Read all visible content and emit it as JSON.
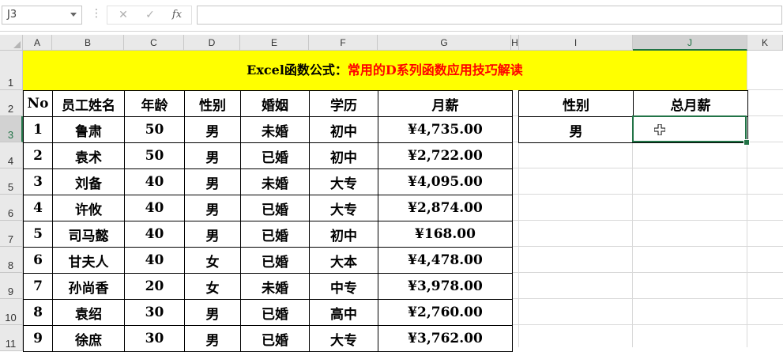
{
  "formula_bar": {
    "name_box": "J3",
    "cancel_icon": "✕",
    "enter_icon": "✓",
    "fx_label": "fx",
    "formula": ""
  },
  "columns": [
    "A",
    "B",
    "C",
    "D",
    "E",
    "F",
    "G",
    "H",
    "I",
    "J",
    "K"
  ],
  "rows": [
    "1",
    "2",
    "3",
    "4",
    "5",
    "6",
    "7",
    "8",
    "9",
    "10",
    "11"
  ],
  "selected_cell": "J3",
  "title": {
    "part1": "Excel函数公式：",
    "part2": "常用的D系列函数应用技巧解读"
  },
  "colors": {
    "title_bg": "#ffff00",
    "title_accent": "#ff0000",
    "selection": "#217346"
  },
  "table": {
    "headers": [
      "No",
      "员工姓名",
      "年龄",
      "性别",
      "婚姻",
      "学历",
      "月薪"
    ],
    "rows": [
      [
        "1",
        "鲁肃",
        "50",
        "男",
        "未婚",
        "初中",
        "¥4,735.00"
      ],
      [
        "2",
        "袁术",
        "50",
        "男",
        "已婚",
        "初中",
        "¥2,722.00"
      ],
      [
        "3",
        "刘备",
        "40",
        "男",
        "未婚",
        "大专",
        "¥4,095.00"
      ],
      [
        "4",
        "许攸",
        "40",
        "男",
        "已婚",
        "大专",
        "¥2,874.00"
      ],
      [
        "5",
        "司马懿",
        "40",
        "男",
        "已婚",
        "初中",
        "¥168.00"
      ],
      [
        "6",
        "甘夫人",
        "40",
        "女",
        "已婚",
        "大本",
        "¥4,478.00"
      ],
      [
        "7",
        "孙尚香",
        "20",
        "女",
        "未婚",
        "中专",
        "¥3,978.00"
      ],
      [
        "8",
        "袁绍",
        "30",
        "男",
        "已婚",
        "高中",
        "¥2,760.00"
      ],
      [
        "9",
        "徐庶",
        "30",
        "男",
        "已婚",
        "大专",
        "¥3,762.00"
      ]
    ]
  },
  "criteria": {
    "headers": [
      "性别",
      "总月薪"
    ],
    "values": [
      "男",
      ""
    ]
  }
}
